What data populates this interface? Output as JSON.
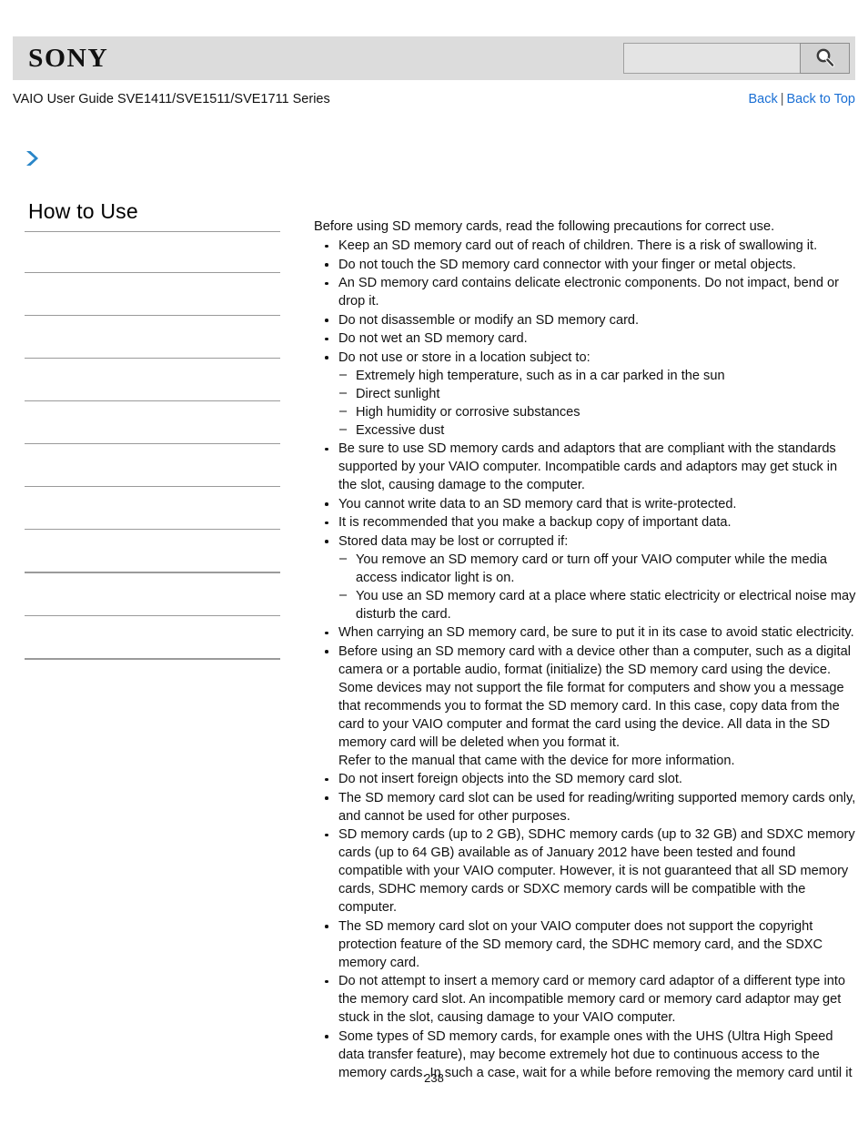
{
  "header": {
    "logo_text": "SONY",
    "search": {
      "value": "",
      "placeholder": "",
      "icon": "search-icon",
      "button_label": ""
    }
  },
  "sub_header": {
    "guide_title": "VAIO User Guide SVE1411/SVE1511/SVE1711 Series",
    "links": {
      "back": "Back",
      "separator": "|",
      "back_to_top": "Back to Top"
    },
    "link_color": "#1a6fd4"
  },
  "breadcrumb": {
    "icon": "chevron-right-icon",
    "icon_color": "#2a86c8",
    "text": ""
  },
  "sidebar": {
    "heading": "How to Use",
    "items": [
      {
        "label": "",
        "rule": "thin"
      },
      {
        "label": "",
        "rule": "thin"
      },
      {
        "label": "",
        "rule": "thin"
      },
      {
        "label": "",
        "rule": "thin"
      },
      {
        "label": "",
        "rule": "thin"
      },
      {
        "label": "",
        "rule": "thin"
      },
      {
        "label": "",
        "rule": "thin"
      },
      {
        "label": "",
        "rule": "thick"
      },
      {
        "label": "",
        "rule": "thin"
      },
      {
        "label": "",
        "rule": "thick"
      }
    ]
  },
  "content": {
    "intro": "Before using SD memory cards, read the following precautions for correct use.",
    "bullets": [
      {
        "text": "Keep an SD memory card out of reach of children. There is a risk of swallowing it."
      },
      {
        "text": "Do not touch the SD memory card connector with your finger or metal objects."
      },
      {
        "text": "An SD memory card contains delicate electronic components. Do not impact, bend or drop it."
      },
      {
        "text": "Do not disassemble or modify an SD memory card."
      },
      {
        "text": "Do not wet an SD memory card."
      },
      {
        "text": "Do not use or store in a location subject to:",
        "sub": [
          "Extremely high temperature, such as in a car parked in the sun",
          "Direct sunlight",
          "High humidity or corrosive substances",
          "Excessive dust"
        ]
      },
      {
        "text": "Be sure to use SD memory cards and adaptors that are compliant with the standards supported by your VAIO computer. Incompatible cards and adaptors may get stuck in the slot, causing damage to the computer."
      },
      {
        "text": "You cannot write data to an SD memory card that is write-protected."
      },
      {
        "text": "It is recommended that you make a backup copy of important data."
      },
      {
        "text": "Stored data may be lost or corrupted if:",
        "sub": [
          "You remove an SD memory card or turn off your VAIO computer while the media access indicator light is on.",
          "You use an SD memory card at a place where static electricity or electrical noise may disturb the card."
        ]
      },
      {
        "text": "When carrying an SD memory card, be sure to put it in its case to avoid static electricity."
      },
      {
        "text": "Before using an SD memory card with a device other than a computer, such as a digital camera or a portable audio, format (initialize) the SD memory card using the device. Some devices may not support the file format for computers and show you a message that recommends you to format the SD memory card. In this case, copy data from the card to your VAIO computer and format the card using the device. All data in the SD memory card will be deleted when you format it.",
        "extra": "Refer to the manual that came with the device for more information."
      },
      {
        "text": "Do not insert foreign objects into the SD memory card slot."
      },
      {
        "text": "The SD memory card slot can be used for reading/writing supported memory cards only, and cannot be used for other purposes."
      },
      {
        "text": "SD memory cards (up to 2 GB), SDHC memory cards (up to 32 GB) and SDXC memory cards (up to 64 GB) available as of January 2012 have been tested and found compatible with your VAIO computer. However, it is not guaranteed that all SD memory cards, SDHC memory cards or SDXC memory cards will be compatible with the computer."
      },
      {
        "text": "The SD memory card slot on your VAIO computer does not support the copyright protection feature of the SD memory card, the SDHC memory card, and the SDXC memory card."
      },
      {
        "text": "Do not attempt to insert a memory card or memory card adaptor of a different type into the memory card slot. An incompatible memory card or memory card adaptor may get stuck in the slot, causing damage to your VAIO computer."
      },
      {
        "text": "Some types of SD memory cards, for example ones with the UHS (Ultra High Speed data transfer feature), may become extremely hot due to continuous access to the memory cards. In such a case, wait for a while before removing the memory card until it"
      }
    ]
  },
  "footer": {
    "page_number": "238"
  }
}
